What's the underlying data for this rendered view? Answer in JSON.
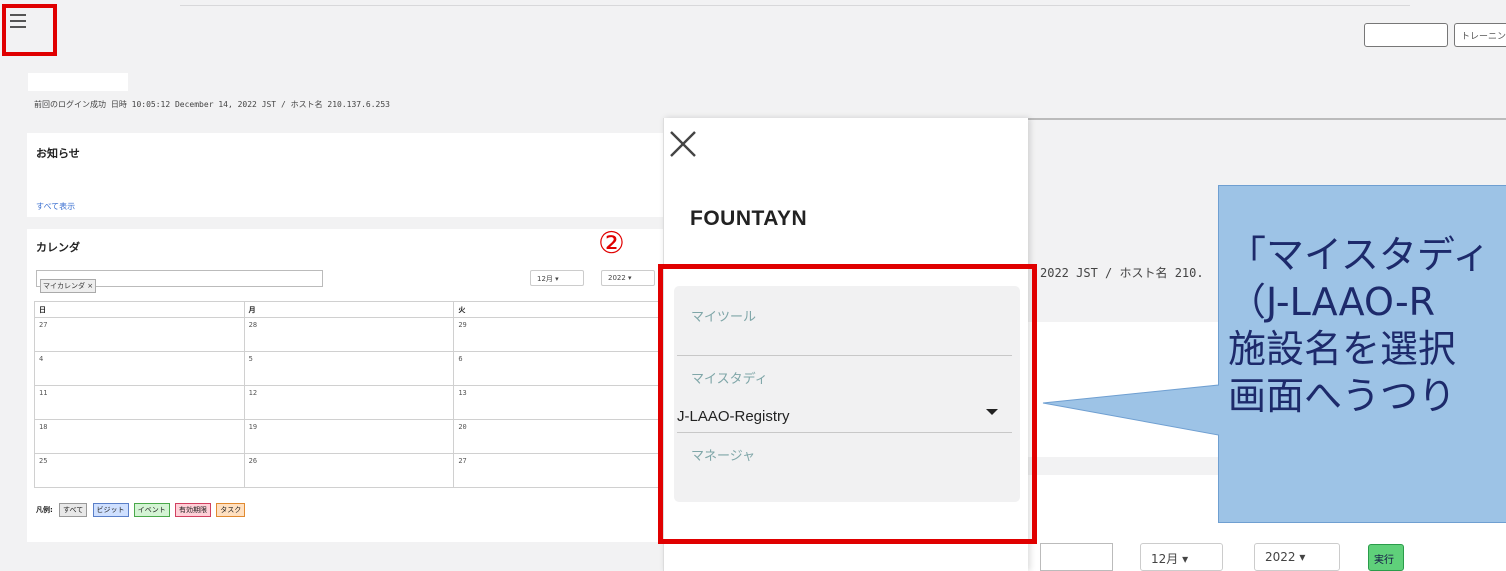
{
  "topbar": {
    "hamburger_icon": "hamburger-menu-icon",
    "buttons": [
      "",
      "トレーニング"
    ]
  },
  "login_info": "前回のログイン成功 日時 10:05:12 December 14, 2022 JST / ホスト名 210.137.6.253",
  "notices": {
    "title": "お知らせ",
    "show_all": "すべて表示"
  },
  "calendar": {
    "title": "カレンダ",
    "tag": "マイカレンダ ×",
    "month": "12月 ▾",
    "year": "2022 ▾",
    "headers": [
      "日",
      "月",
      "火"
    ],
    "rows": [
      [
        "27",
        "28",
        "29"
      ],
      [
        "4",
        "5",
        "6"
      ],
      [
        "11",
        "12",
        "13"
      ],
      [
        "18",
        "19",
        "20"
      ],
      [
        "25",
        "26",
        "27"
      ]
    ],
    "legend_label": "凡例:",
    "legend": [
      {
        "label": "すべて",
        "color": "#e8e8e8",
        "border": "#999999"
      },
      {
        "label": "ビジット",
        "color": "#cfe0ff",
        "border": "#5a7fc8"
      },
      {
        "label": "イベント",
        "color": "#d4f4d4",
        "border": "#4aa84a"
      },
      {
        "label": "有効期限",
        "color": "#ffd0d8",
        "border": "#d04060"
      },
      {
        "label": "タスク",
        "color": "#ffe0c0",
        "border": "#e08a30"
      }
    ]
  },
  "annotation_number": "②",
  "background_right": {
    "login_partial": "2022 JST / ホスト名 210.",
    "month": "12月 ▾",
    "year": "2022 ▾",
    "run": "実行"
  },
  "drawer": {
    "close_icon": "close-icon",
    "logo": "FOUNTAYN",
    "items": {
      "my_tools": "マイツール",
      "my_study": "マイスタディ",
      "study_value": "J-LAAO-Registry",
      "manager": "マネージャ"
    }
  },
  "callout": {
    "lines": [
      "「マイスタディ",
      "（J-LAAO-R",
      "施設名を選択",
      "画面へうつり"
    ],
    "fill": "#9dc3e6",
    "stroke": "#6f9fd1"
  },
  "colors": {
    "highlight": "#e00000",
    "accent_text": "#7fa6a8"
  }
}
